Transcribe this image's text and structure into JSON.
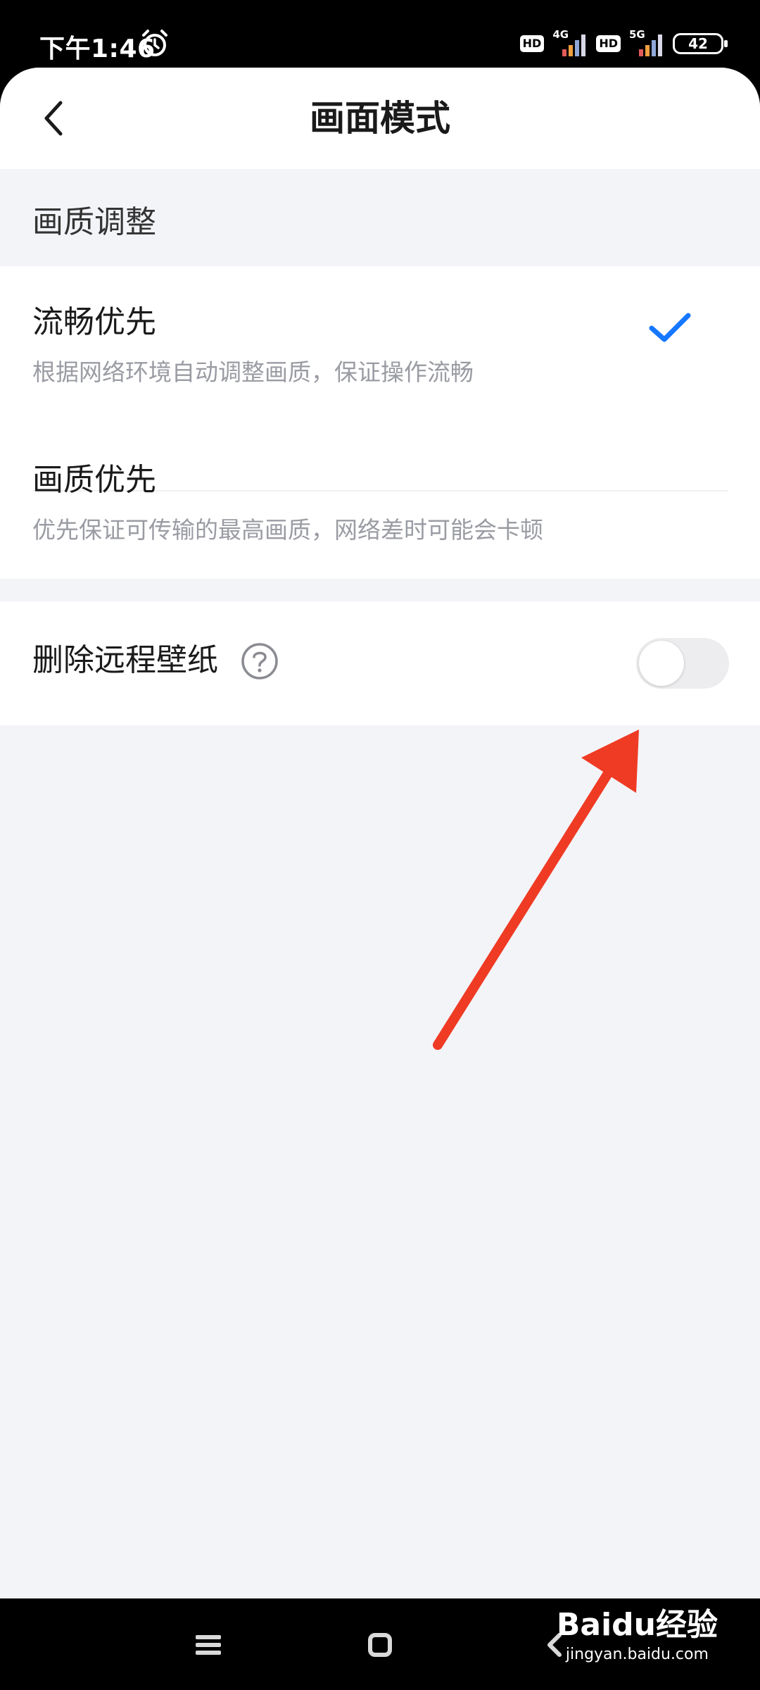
{
  "status_bar": {
    "time": "下午1:46",
    "hd_badge": "HD",
    "network_1": "4G",
    "network_2": "5G",
    "battery": "42",
    "icons": [
      "alarm-icon",
      "signal-icon",
      "battery-icon"
    ]
  },
  "header": {
    "title": "画面模式",
    "back_icon": "chevron-left-icon"
  },
  "quality_section": {
    "header": "画质调整",
    "options": [
      {
        "title": "流畅优先",
        "description": "根据网络环境自动调整画质，保证操作流畅",
        "selected": true
      },
      {
        "title": "画质优先",
        "description": "优先保证可传输的最高画质，网络差时可能会卡顿",
        "selected": false
      }
    ]
  },
  "remote_wallpaper": {
    "label": "删除远程壁纸",
    "help_icon": "question-circle-icon",
    "enabled": false
  },
  "watermark": {
    "brand": "Baidu经验",
    "url": "jingyan.baidu.com"
  },
  "colors": {
    "accent": "#1677ff",
    "annotation_arrow": "#ef3b24",
    "background": "#f3f4f8",
    "toggle_off": "#ededef"
  }
}
